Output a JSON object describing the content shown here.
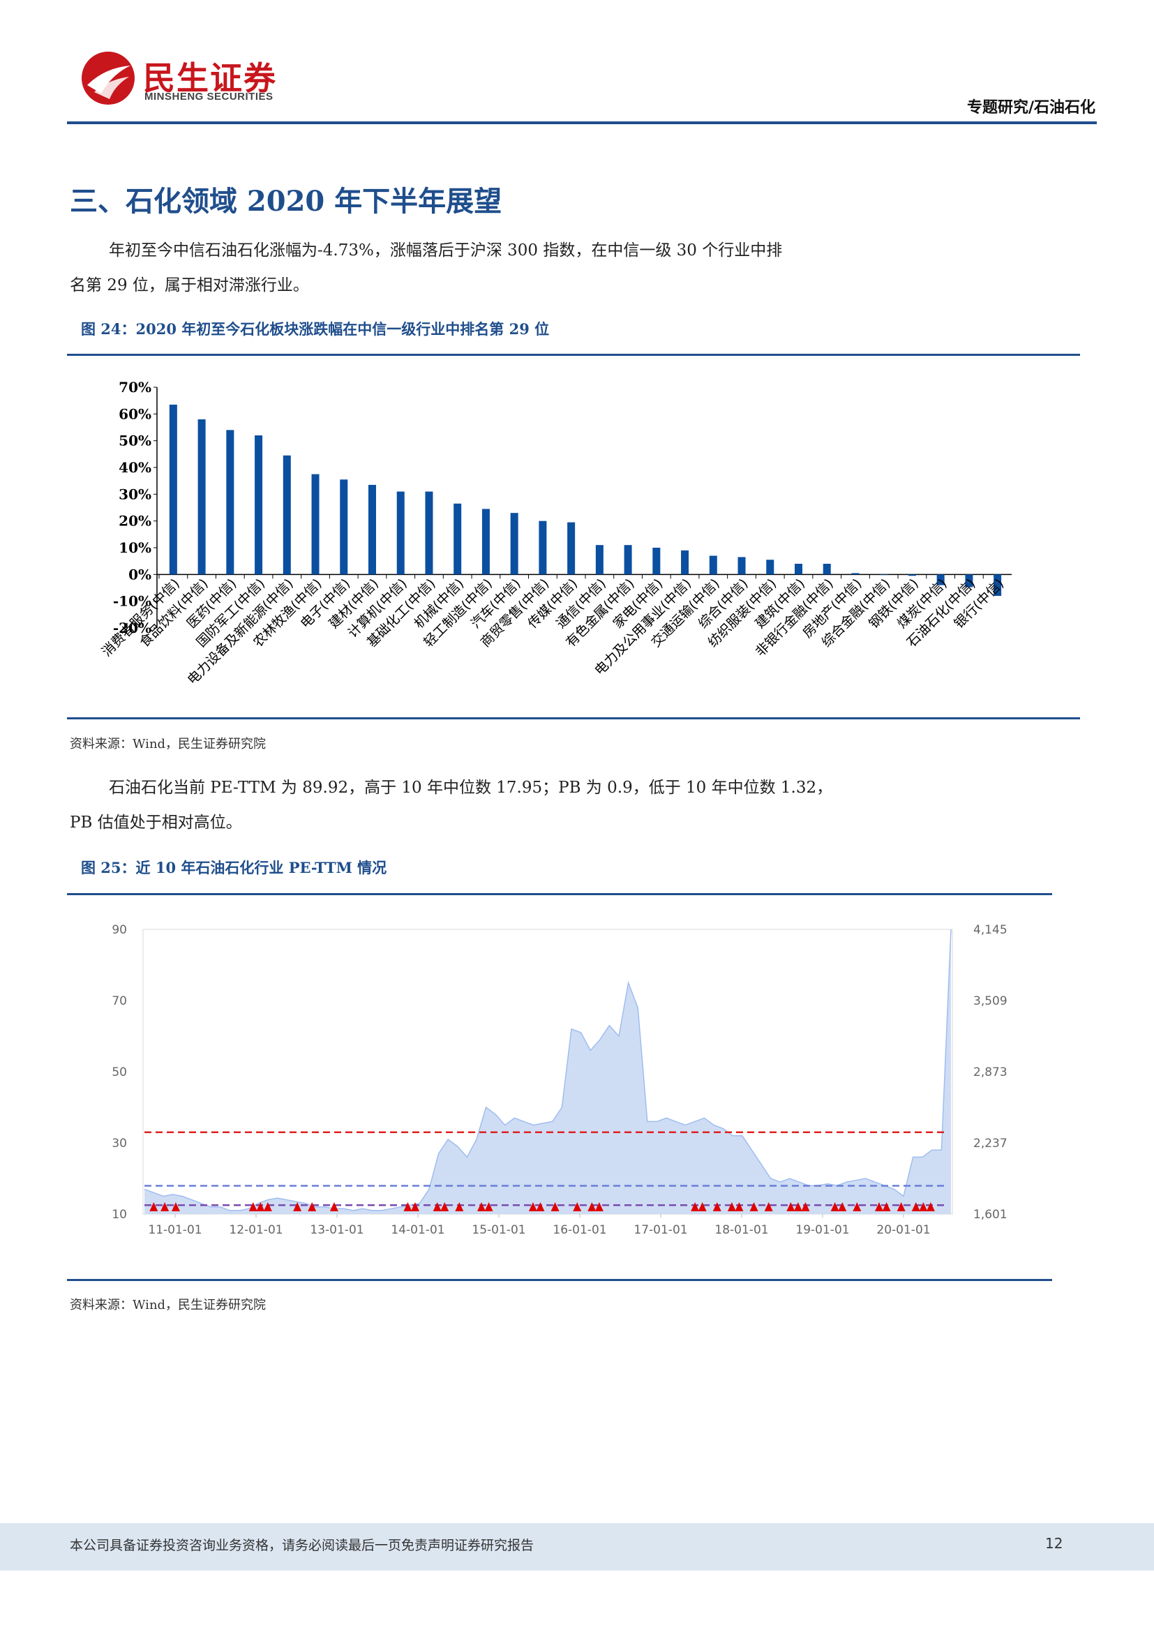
{
  "header": {
    "logo_cn": "民生证券",
    "logo_en": "MINSHENG SECURITIES",
    "category": "专题研究/石油石化"
  },
  "section": {
    "title": "三、石化领域 2020 年下半年展望"
  },
  "paragraphs": {
    "p1_line1": "年初至今中信石油石化涨幅为-4.73%，涨幅落后于沪深 300 指数，在中信一级 30 个行业中排",
    "p1_line2": "名第 29 位，属于相对滞涨行业。",
    "p2_line1": "石油石化当前 PE-TTM 为 89.92，高于 10 年中位数 17.95；PB 为 0.9，低于 10 年中位数 1.32，",
    "p2_line2": "PB 估值处于相对高位。"
  },
  "figure24": {
    "title": "图 24：2020 年初至今石化板块涨跌幅在中信一级行业中排名第 29 位",
    "source": "资料来源：Wind，民生证券研究院"
  },
  "figure25": {
    "title": "图 25：近 10 年石油石化行业 PE-TTM 情况",
    "source": "资料来源：Wind，民生证券研究院"
  },
  "chart_data": [
    {
      "type": "bar",
      "categories": [
        "消费者服务(中信)",
        "食品饮料(中信)",
        "医药(中信)",
        "国防军工(中信)",
        "电力设备及新能源(中信)",
        "农林牧渔(中信)",
        "电子(中信)",
        "建材(中信)",
        "计算机(中信)",
        "基础化工(中信)",
        "机械(中信)",
        "轻工制造(中信)",
        "汽车(中信)",
        "商贸零售(中信)",
        "传媒(中信)",
        "通信(中信)",
        "有色金属(中信)",
        "家电(中信)",
        "电力及公用事业(中信)",
        "交通运输(中信)",
        "综合(中信)",
        "纺织服装(中信)",
        "建筑(中信)",
        "非银行金融(中信)",
        "房地产(中信)",
        "综合金融(中信)",
        "钢铁(中信)",
        "煤炭(中信)",
        "石油石化(中信)",
        "银行(中信)"
      ],
      "values": [
        63.5,
        58,
        54,
        52,
        44.5,
        37.5,
        35.5,
        33.5,
        31,
        31,
        26.5,
        24.5,
        23,
        20,
        19.5,
        11,
        11,
        10,
        9,
        7,
        6.5,
        5.5,
        4,
        4,
        0.5,
        0,
        -0.5,
        -4,
        -4.73,
        -8
      ],
      "ylim": [
        -20,
        70
      ],
      "yticks": [
        "70%",
        "60%",
        "50%",
        "40%",
        "30%",
        "20%",
        "10%",
        "0%",
        "-10%",
        "-20%"
      ],
      "color": "#0b4fa0"
    },
    {
      "type": "area",
      "x_ticks": [
        "11-01-01",
        "12-01-01",
        "13-01-01",
        "14-01-01",
        "15-01-01",
        "16-01-01",
        "17-01-01",
        "18-01-01",
        "19-01-01",
        "20-01-01"
      ],
      "y_left_ticks": [
        "90",
        "70",
        "50",
        "30",
        "10"
      ],
      "y_right_ticks": [
        "4,145",
        "3,509",
        "2,873",
        "2,237",
        "1,601"
      ],
      "ylim": [
        10,
        90
      ],
      "series": [
        {
          "values": [
            17,
            16,
            15,
            15.5,
            15,
            14,
            13,
            12,
            12,
            11,
            11,
            11.5,
            13,
            14,
            14.5,
            14,
            13.5,
            13,
            12,
            12,
            11.5,
            11.5,
            11,
            11.5,
            11,
            11,
            11.5,
            12,
            12.5,
            13,
            17,
            27,
            31,
            29,
            26,
            31,
            40,
            38,
            35,
            37,
            36,
            35,
            35.5,
            36,
            40,
            62,
            61,
            56,
            59,
            63,
            60,
            75,
            68,
            36,
            36,
            37,
            36,
            35,
            36,
            37,
            35,
            34,
            32,
            32,
            28,
            24,
            20,
            19,
            20,
            19,
            18,
            18,
            18.5,
            18,
            19,
            19.5,
            20,
            19,
            18,
            17,
            15,
            26,
            26,
            28,
            28,
            89.92
          ]
        }
      ],
      "reference_lines": [
        {
          "value": 33,
          "color": "#e02020"
        },
        {
          "value": 17.95,
          "color": "#6a7fd8"
        },
        {
          "value": 12.5,
          "color": "#7a4bb0"
        }
      ],
      "markers_x": [
        0.5,
        2,
        3.5,
        14,
        15,
        16,
        20,
        22,
        25,
        35,
        36,
        39,
        40,
        42,
        45,
        46,
        52,
        53,
        55,
        58,
        60,
        61,
        74,
        75,
        77,
        79,
        80,
        82,
        84,
        87,
        88,
        89,
        93,
        94,
        96,
        99,
        100,
        102,
        104,
        105,
        106
      ],
      "marker_color": "#e00000",
      "fill_color": "#c5d7f2",
      "line_color": "#9fbdf0"
    }
  ],
  "footer": {
    "disclaimer": "本公司具备证券投资咨询业务资格，请务必阅读最后一页免责声明证券研究报告",
    "page": "12"
  }
}
